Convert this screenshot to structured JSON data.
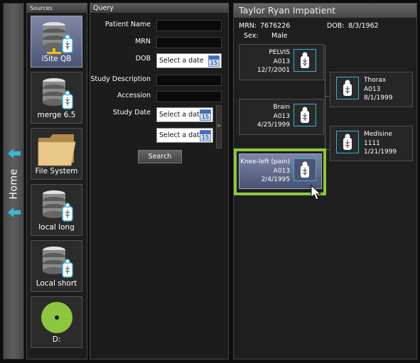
{
  "home": {
    "label": "Home"
  },
  "sources": {
    "header": "Sources",
    "items": [
      {
        "label": "iSite QB",
        "icon": "database-device-icon",
        "active": true
      },
      {
        "label": "merge 6.5",
        "icon": "database-device-icon",
        "active": false
      },
      {
        "label": "File System",
        "icon": "folder-icon",
        "active": false
      },
      {
        "label": "local long",
        "icon": "database-device-icon",
        "active": false
      },
      {
        "label": "Local short",
        "icon": "database-device-icon",
        "active": false
      },
      {
        "label": "D:",
        "icon": "disc-icon",
        "active": false
      }
    ]
  },
  "query": {
    "header": "Query",
    "patient_name_label": "Patient Name",
    "patient_name_value": "",
    "mrn_label": "MRN",
    "mrn_value": "",
    "dob_label": "DOB",
    "dob_placeholder": "Select a date",
    "study_description_label": "Study Description",
    "study_description_value": "",
    "accession_label": "Accession",
    "accession_value": "",
    "study_date_label": "Study Date",
    "study_date_from_placeholder": "Select a date",
    "study_date_to_placeholder": "Select a date",
    "calendar_day": "15",
    "search_label": "Search"
  },
  "patient": {
    "title": "Taylor Ryan Impatient",
    "mrn_label": "MRN:",
    "mrn_value": "7676226",
    "dob_label": "DOB:",
    "dob_value": "8/3/1962",
    "sex_label": "Sex:",
    "sex_value": "Male"
  },
  "studies": [
    {
      "name": "PELVIS",
      "code": "A013",
      "date": "12/7/2001",
      "selected": false
    },
    {
      "name": "Thorax",
      "code": "A013",
      "date": "8/1/1999",
      "selected": false
    },
    {
      "name": "Brain",
      "code": "A013",
      "date": "4/25/1999",
      "selected": false
    },
    {
      "name": "Medisine",
      "code": "1111",
      "date": "1/21/1999",
      "selected": false
    },
    {
      "name": "Knee-left (pain)",
      "code": "A013",
      "date": "2/4/1995",
      "selected": true
    }
  ],
  "colors": {
    "accent": "#2fb4d8",
    "highlight": "#8ec63f",
    "active_tile": "#6b7394",
    "disc": "#8ec63f"
  }
}
